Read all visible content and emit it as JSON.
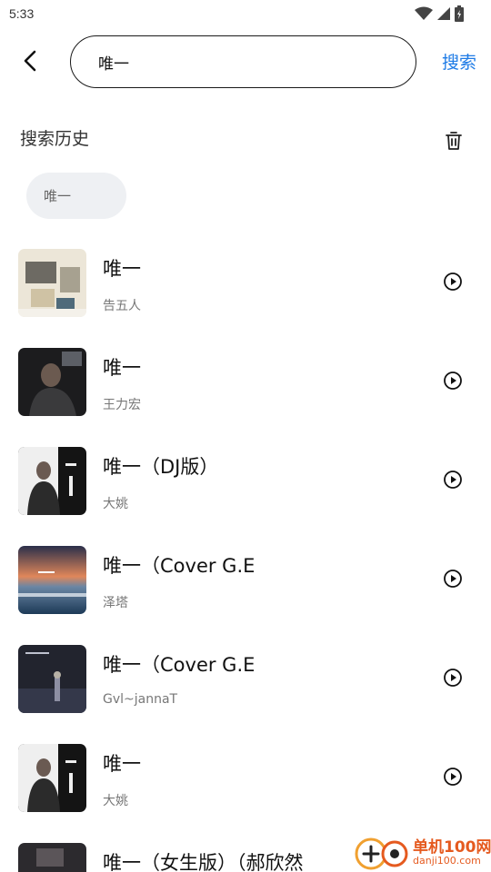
{
  "status_bar": {
    "time": "5:33",
    "icons": [
      "wifi-icon",
      "signal-icon",
      "battery-charging-icon"
    ]
  },
  "search": {
    "value": "唯一",
    "submit_label": "搜索"
  },
  "history": {
    "title": "搜索历史",
    "items": [
      "唯一"
    ]
  },
  "colors": {
    "accent": "#1e7be6",
    "chip_bg": "#eef0f3",
    "secondary_text": "#777777"
  },
  "songs": [
    {
      "title": "唯一",
      "artist": "告五人"
    },
    {
      "title": "唯一",
      "artist": "王力宏"
    },
    {
      "title": "唯一（DJ版）",
      "artist": "大姚"
    },
    {
      "title": "唯一（Cover G.E",
      "artist": "泽塔"
    },
    {
      "title": "唯一（Cover G.E",
      "artist": "Gvl~jannaT"
    },
    {
      "title": "唯一",
      "artist": "大姚"
    },
    {
      "title": "唯一（女生版）（郝欣然",
      "artist": ""
    }
  ],
  "watermark": {
    "line1": "单机100网",
    "line2": "danji100.com"
  }
}
